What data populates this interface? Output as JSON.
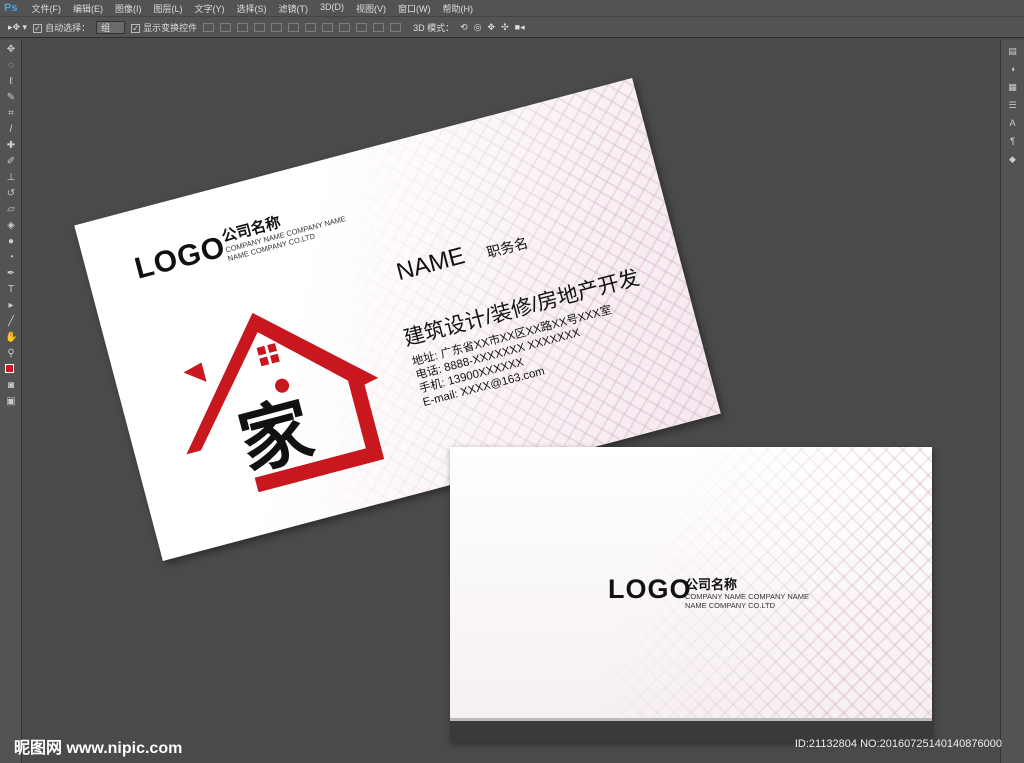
{
  "app": {
    "logo": "Ps",
    "menu": [
      "文件(F)",
      "编辑(E)",
      "图像(I)",
      "图层(L)",
      "文字(Y)",
      "选择(S)",
      "滤镜(T)",
      "3D(D)",
      "视图(V)",
      "窗口(W)",
      "帮助(H)"
    ]
  },
  "options": {
    "auto_select_label": "自动选择：",
    "auto_select_value": "组",
    "show_transform_label": "显示变换控件",
    "mode_3d_label": "3D 模式："
  },
  "card_front": {
    "logo": "LOGO",
    "company": "公司名称",
    "company_en1": "COMPANY NAME COMPANY NAME",
    "company_en2": "NAME COMPANY CO.LTD",
    "name": "NAME",
    "title": "职务名",
    "business": "建筑设计/装修/房地产开发",
    "address": "地址: 广东省XX市XX区XX路XX号XXX室",
    "phone": "电话: 8888-XXXXXXX   XXXXXXX",
    "mobile": "手机: 13900XXXXXX",
    "email": "E-mail: XXXX@163.com",
    "house_char": "家"
  },
  "card_back": {
    "logo": "LOGO",
    "company": "公司名称",
    "company_en1": "COMPANY NAME COMPANY NAME",
    "company_en2": "NAME COMPANY CO.LTD"
  },
  "watermark": "昵图网 www.nipic.com",
  "image_id": "ID:21132804 NO:20160725140140876000",
  "colors": {
    "accent": "#c8171e"
  }
}
